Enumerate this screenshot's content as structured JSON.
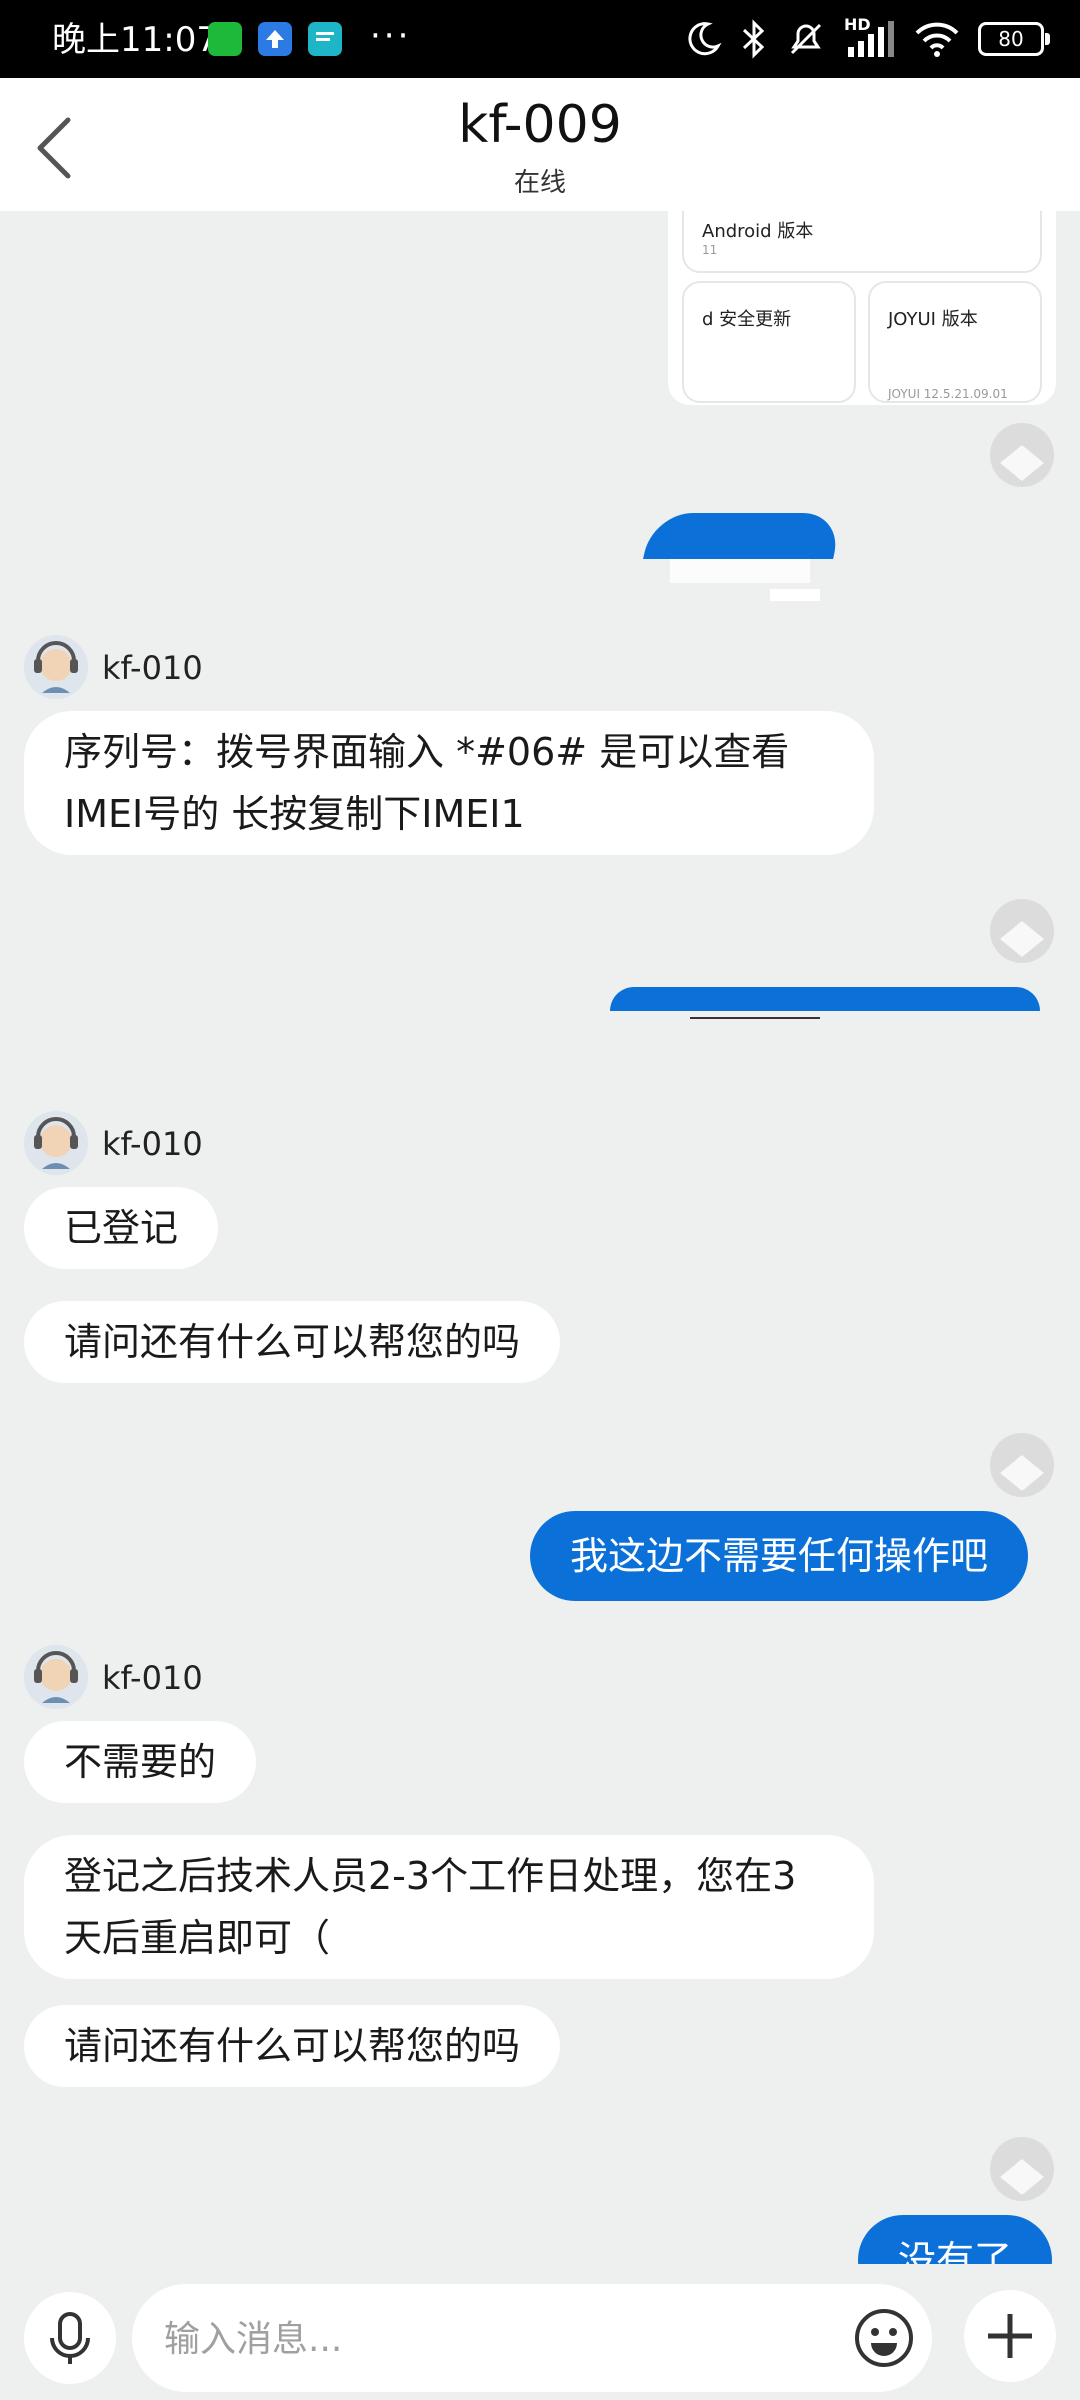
{
  "status_bar": {
    "time": "晚上11:07",
    "more": "···",
    "hd": "HD",
    "battery": "80"
  },
  "header": {
    "title": "kf-009",
    "subtitle": "在线"
  },
  "card": {
    "android_label": "Android 版本",
    "android_value": "11",
    "security_label": "d 安全更新",
    "joyui_label": "JOYUI 版本",
    "joyui_value": "JOYUI 12.5.21.09.01"
  },
  "messages": [
    {
      "sender": "kf-010",
      "texts": [
        "序列号：拨号界面输入 *#06# 是可以查看IMEI号的  长按复制下IMEI1"
      ]
    },
    {
      "sender": "kf-010",
      "texts": [
        "已登记",
        "请问还有什么可以帮您的吗"
      ]
    },
    {
      "mine": "我这边不需要任何操作吧"
    },
    {
      "sender": "kf-010",
      "texts": [
        "不需要的",
        "登记之后技术人员2-3个工作日处理，您在3天后重启即可（",
        "请问还有什么可以帮您的吗"
      ]
    },
    {
      "mine": "没有了"
    }
  ],
  "input": {
    "placeholder": "输入消息..."
  },
  "icons": [
    "back-icon",
    "mic-icon",
    "emoji-icon",
    "plus-icon",
    "moon-icon",
    "bluetooth-icon",
    "mute-icon",
    "signal-icon",
    "wifi-icon",
    "battery-icon"
  ],
  "colors": {
    "accent": "#0b71d9",
    "background": "#eeefef",
    "bubble_left": "#ffffff"
  }
}
